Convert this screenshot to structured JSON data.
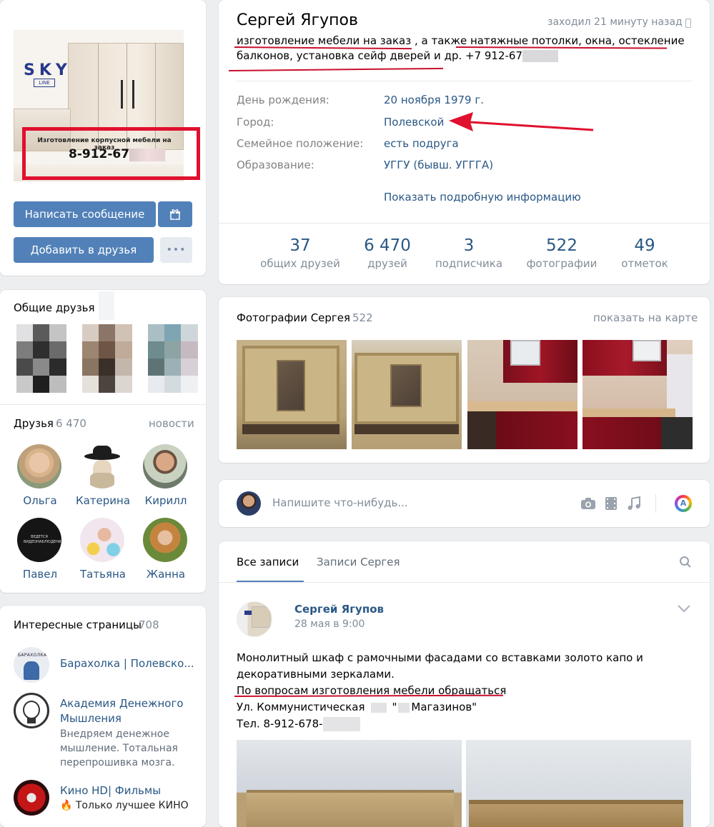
{
  "profile": {
    "name": "Сергей Ягупов",
    "last_seen": "заходил 21 минуту назад",
    "status_line1_a": "изготовление мебели на заказ",
    "status_line1_b": " , а также ",
    "status_line1_c": "натяжные потолки, окна, остекление",
    "status_line2": "балконов, установка сейф дверей и др. +7 912-678-",
    "info": [
      {
        "label": "День рождения:",
        "value": "20 ноября 1979 г."
      },
      {
        "label": "Город:",
        "value": "Полевской"
      },
      {
        "label": "Семейное положение:",
        "value": "есть подруга"
      },
      {
        "label": "Образование:",
        "value": "УГГУ (бывш. УГГГА)"
      }
    ],
    "show_more": "Показать подробную информацию",
    "stats": [
      {
        "num": "37",
        "label": "общих друзей"
      },
      {
        "num": "6 470",
        "label": "друзей"
      },
      {
        "num": "3",
        "label": "подписчика"
      },
      {
        "num": "522",
        "label": "фотографии"
      },
      {
        "num": "49",
        "label": "отметок"
      }
    ]
  },
  "avatar_card": {
    "logo_text": "SKY",
    "logo_sub": "LINE",
    "ad_text": "Изготовление корпусной мебели на заказ",
    "ad_phone": "8-912-678-",
    "message_button": "Написать сообщение",
    "add_friend_button": "Добавить в друзья",
    "more_button": "•••"
  },
  "common_friends": {
    "title": "Общие друзья"
  },
  "friends": {
    "title": "Друзья",
    "count": "6 470",
    "news_link": "новости",
    "items": [
      "Ольга",
      "Катерина",
      "Кирилл",
      "Павел",
      "Татьяна",
      "Жанна"
    ],
    "pavel_avatar_text": "ВЕДЕТСЯ ВИДЕОНАБЛЮДЕНИЕ"
  },
  "pages": {
    "title": "Интересные страницы",
    "count": "708",
    "items": [
      {
        "name": "Барахолка | Полевско...",
        "desc": "",
        "avatar_text": "БАРАХОЛКА"
      },
      {
        "name": "Академия Денежного Мышления",
        "desc": "Внедряем денежное мышление. Тотальная перепрошивка мозга."
      },
      {
        "name": "Кино HD| Фильмы",
        "desc": "🔥 Только лучшее КИНО"
      }
    ]
  },
  "photos": {
    "title": "Фотографии Сергея",
    "count": "522",
    "map_link": "показать на карте"
  },
  "composer": {
    "placeholder": "Напишите что-нибудь..."
  },
  "wall": {
    "tabs": [
      "Все записи",
      "Записи Сергея"
    ],
    "post": {
      "author": "Сергей Ягупов",
      "date": "28 мая в 9:00",
      "line1": "Монолитный шкаф с рамочными фасадами со вставками золото капо и",
      "line2": "декоративными зеркалами.",
      "line3": "По вопросам изготовления мебели обращаться",
      "line4_a": "Ул. Коммунистическая",
      "line4_b": "\"",
      "line4_c": "Магазинов\"",
      "line5": "Тел. 8-912-678-"
    }
  },
  "colors": {
    "accent": "#5181b8",
    "link": "#2a5885",
    "underline": "#c8102e",
    "arrow": "#e0102e",
    "background": "#edeef0"
  }
}
